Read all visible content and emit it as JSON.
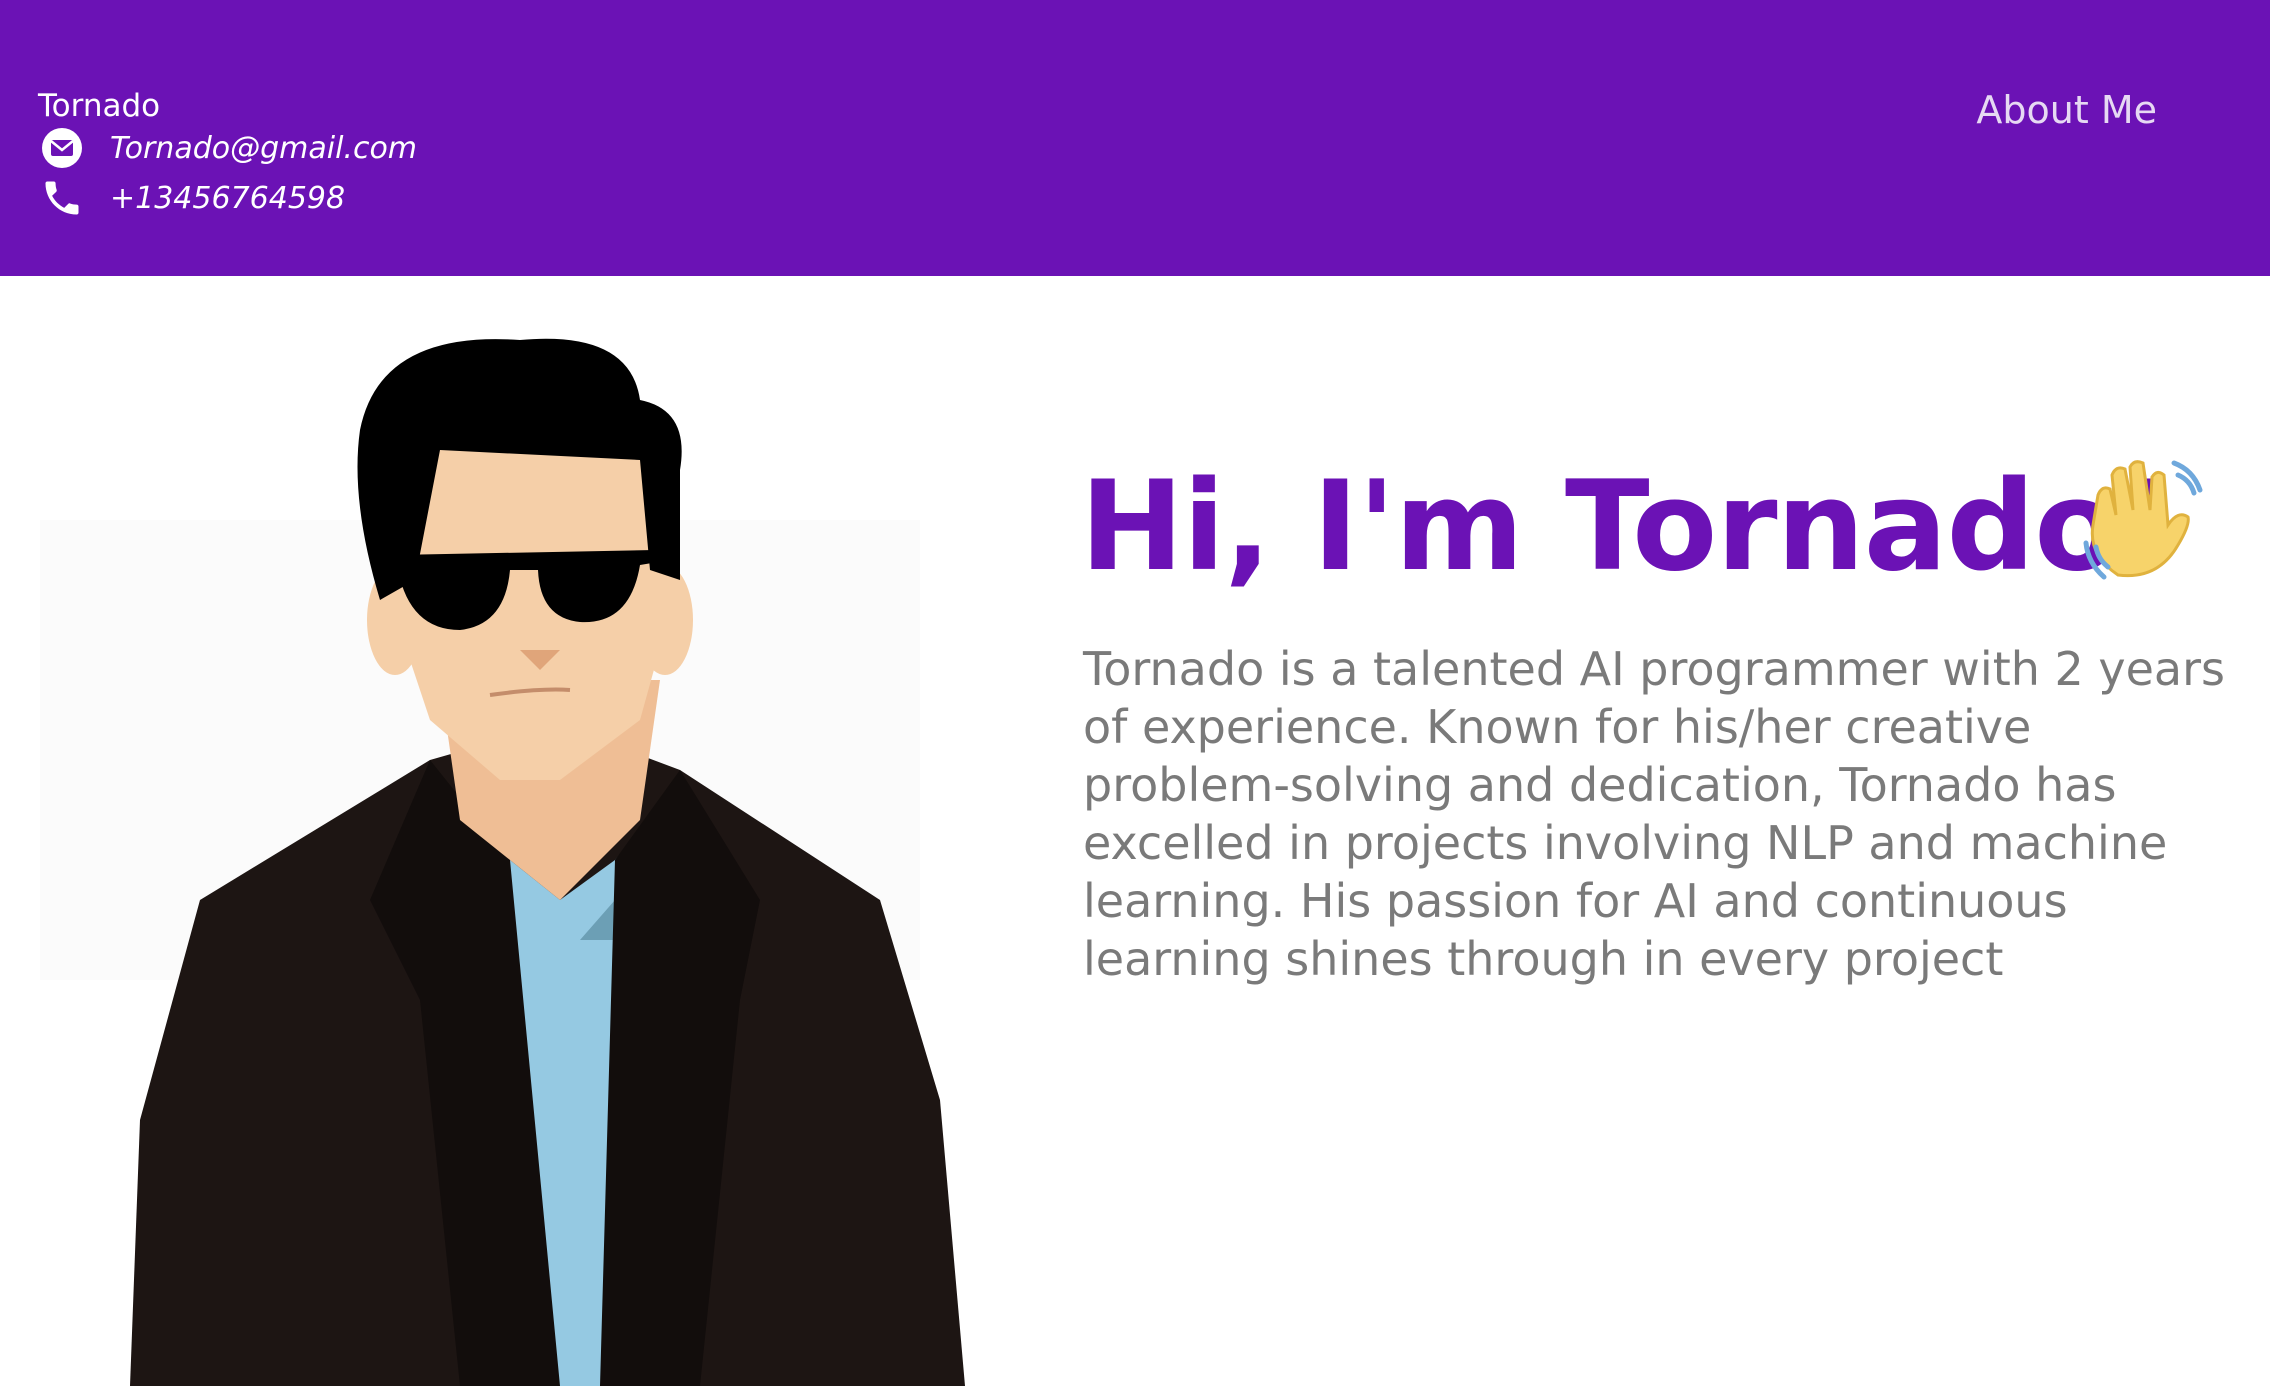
{
  "header": {
    "brand_name": "Tornado",
    "email": "Tornado@gmail.com",
    "phone": "+13456764598",
    "nav": {
      "about_label": "About Me"
    },
    "colors": {
      "background": "#6b12b5",
      "text": "#ffffff"
    },
    "icons": {
      "email": "envelope-icon",
      "phone": "phone-icon"
    }
  },
  "hero": {
    "title": "Hi, I'm Tornado!",
    "title_color": "#6b12b5",
    "emoji": "waving-hand-icon",
    "bio": "Tornado is a talented AI programmer with 2 years of experience. Known for his/her creative problem-solving and dedication, Tornado has excelled in projects involving NLP and machine learning. His passion for AI and continuous learning shines through in every project",
    "bio_color": "#7a7a7a"
  },
  "portrait": {
    "description_icon": "avatar-illustration"
  }
}
